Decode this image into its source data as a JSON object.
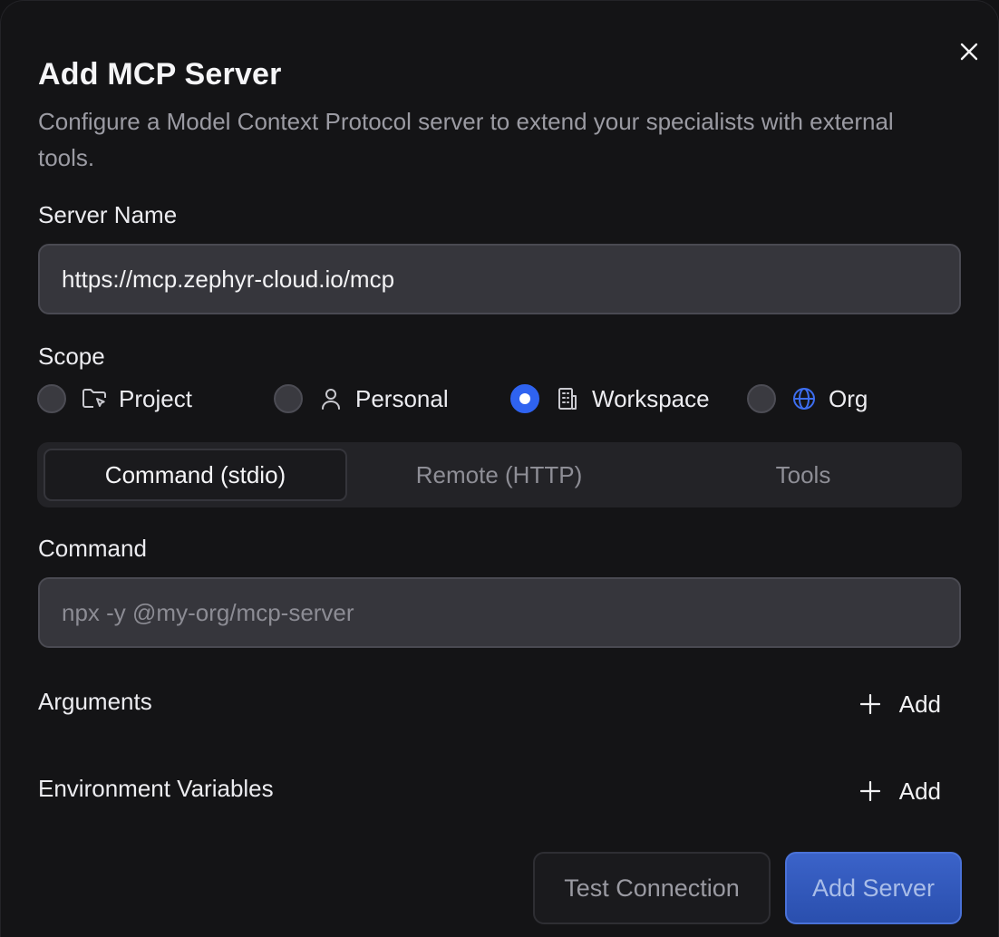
{
  "dialog": {
    "title": "Add MCP Server",
    "description": "Configure a Model Context Protocol server to extend your specialists with external tools."
  },
  "server_name": {
    "label": "Server Name",
    "value": "https://mcp.zephyr-cloud.io/mcp"
  },
  "scope": {
    "label": "Scope",
    "options": [
      {
        "label": "Project",
        "icon": "folder-icon",
        "selected": false
      },
      {
        "label": "Personal",
        "icon": "user-icon",
        "selected": false
      },
      {
        "label": "Workspace",
        "icon": "building-icon",
        "selected": true
      },
      {
        "label": "Org",
        "icon": "globe-icon",
        "selected": false
      }
    ]
  },
  "tabs": [
    {
      "label": "Command (stdio)",
      "active": true
    },
    {
      "label": "Remote (HTTP)",
      "active": false
    },
    {
      "label": "Tools",
      "active": false
    }
  ],
  "command": {
    "label": "Command",
    "value": "",
    "placeholder": "npx -y @my-org/mcp-server"
  },
  "arguments": {
    "label": "Arguments",
    "add_label": "Add"
  },
  "env_vars": {
    "label": "Environment Variables",
    "add_label": "Add"
  },
  "footer": {
    "test_label": "Test Connection",
    "submit_label": "Add Server"
  },
  "colors": {
    "accent": "#2f63f0",
    "background": "#141416",
    "input_bg": "#36363c",
    "globe_icon": "#3d6ef0"
  }
}
